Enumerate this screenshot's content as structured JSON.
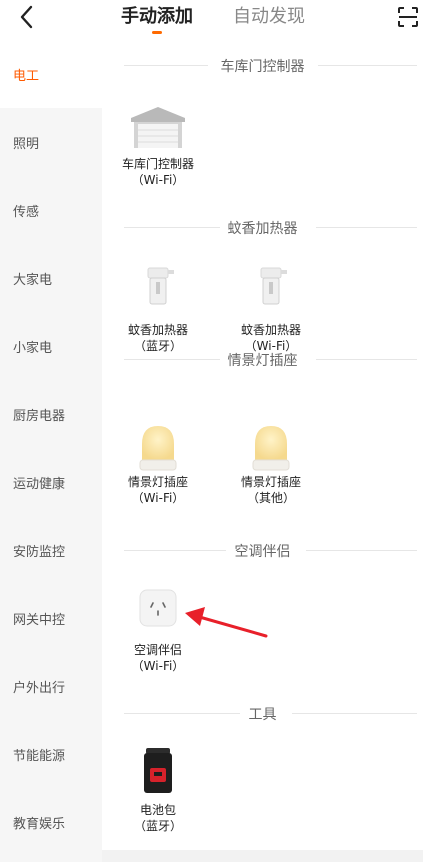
{
  "header": {
    "tabs": [
      {
        "label": "手动添加",
        "active": true
      },
      {
        "label": "自动发现",
        "active": false
      }
    ],
    "back_icon": "chevron-left-icon",
    "scan_icon": "scan-icon"
  },
  "sidebar": {
    "items": [
      {
        "label": "电工",
        "active": true
      },
      {
        "label": "照明"
      },
      {
        "label": "传感"
      },
      {
        "label": "大家电"
      },
      {
        "label": "小家电"
      },
      {
        "label": "厨房电器"
      },
      {
        "label": "运动健康"
      },
      {
        "label": "安防监控"
      },
      {
        "label": "网关中控"
      },
      {
        "label": "户外出行"
      },
      {
        "label": "节能能源"
      },
      {
        "label": "教育娱乐"
      }
    ]
  },
  "sections": [
    {
      "title": "车库门控制器",
      "devices": [
        {
          "name": "车库门控制器",
          "sub": "（Wi-Fi）",
          "icon": "garage-door-icon"
        }
      ]
    },
    {
      "title": "蚊香加热器",
      "devices": [
        {
          "name": "蚊香加热器",
          "sub": "（蓝牙）",
          "icon": "mosquito-repellent-icon"
        },
        {
          "name": "蚊香加热器",
          "sub": "（Wi-Fi）",
          "icon": "mosquito-repellent-icon"
        }
      ]
    },
    {
      "title": "情景灯插座",
      "devices": [
        {
          "name": "情景灯插座",
          "sub": "（Wi-Fi）",
          "icon": "night-light-icon"
        },
        {
          "name": "情景灯插座",
          "sub": "（其他）",
          "icon": "night-light-icon"
        }
      ]
    },
    {
      "title": "空调伴侣",
      "devices": [
        {
          "name": "空调伴侣",
          "sub": "（Wi-Fi）",
          "icon": "ac-companion-icon"
        }
      ]
    },
    {
      "title": "工具",
      "devices": [
        {
          "name": "电池包",
          "sub": "（蓝牙）",
          "icon": "battery-pack-icon"
        }
      ]
    }
  ],
  "colors": {
    "accent": "#ff5a00",
    "annotation_arrow": "#e8202a"
  }
}
